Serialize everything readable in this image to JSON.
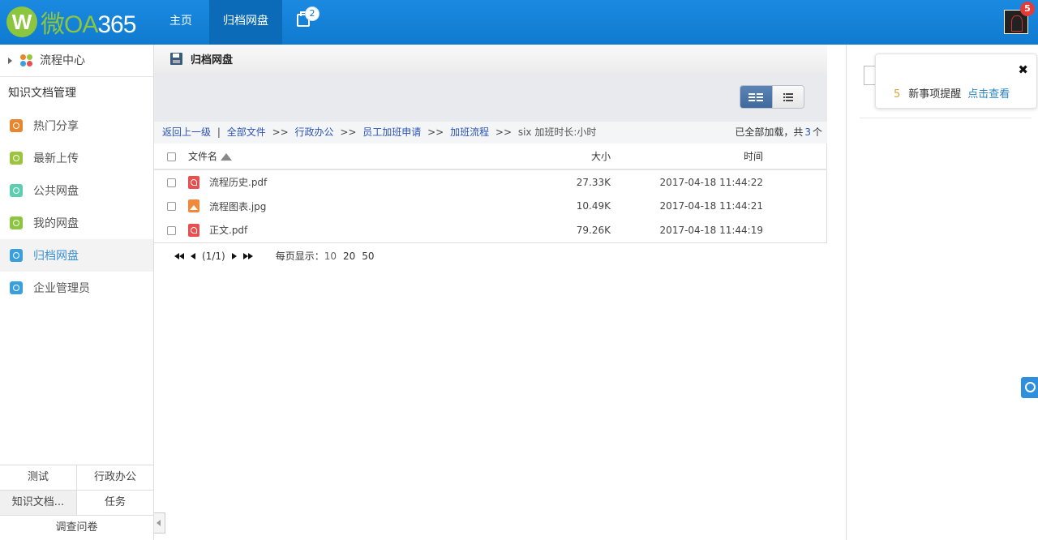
{
  "header": {
    "logo_letter": "W",
    "logo_text_prefix": "微OA",
    "logo_text_suffix": "365",
    "nav": [
      {
        "label": "主页"
      },
      {
        "label": "归档网盘"
      }
    ],
    "message_count": "2",
    "avatar_badge": "5"
  },
  "sidebar": {
    "flow_center": "流程中心",
    "section_title": "知识文档管理",
    "items": [
      {
        "label": "热门分享",
        "color": "#e8862e"
      },
      {
        "label": "最新上传",
        "color": "#9bc53d"
      },
      {
        "label": "公共网盘",
        "color": "#5dcfb0"
      },
      {
        "label": "我的网盘",
        "color": "#8cc63e"
      },
      {
        "label": "归档网盘",
        "color": "#3aa0dd"
      },
      {
        "label": "企业管理员",
        "color": "#3aa0dd"
      }
    ],
    "bottom": {
      "row1": [
        "测试",
        "行政办公"
      ],
      "row2": [
        "知识文档...",
        "任务"
      ],
      "row3": "调查问卷"
    }
  },
  "main": {
    "title": "归档网盘",
    "breadcrumb": {
      "back": "返回上一级",
      "divider": "|",
      "links": [
        "全部文件",
        "行政办公",
        "员工加班申请",
        "加班流程"
      ],
      "current": "six 加班时长:小时",
      "separator": ">>",
      "loaded_prefix": "已全部加载，共",
      "loaded_count": "3",
      "loaded_suffix": "个"
    },
    "table": {
      "headers": {
        "name": "文件名",
        "size": "大小",
        "time": "时间"
      },
      "rows": [
        {
          "name": "流程历史.pdf",
          "type": "pdf",
          "size": "27.33K",
          "time": "2017-04-18 11:44:22"
        },
        {
          "name": "流程图表.jpg",
          "type": "img",
          "size": "10.49K",
          "time": "2017-04-18 11:44:21"
        },
        {
          "name": "正文.pdf",
          "type": "pdf",
          "size": "79.26K",
          "time": "2017-04-18 11:44:19"
        }
      ]
    },
    "pager": {
      "info": "(1/1)",
      "per_page_label": "每页显示：",
      "options": [
        "10",
        "20",
        "50"
      ]
    }
  },
  "notification": {
    "count": "5",
    "text": "新事项提醒",
    "link": "点击查看",
    "close": "✖"
  }
}
